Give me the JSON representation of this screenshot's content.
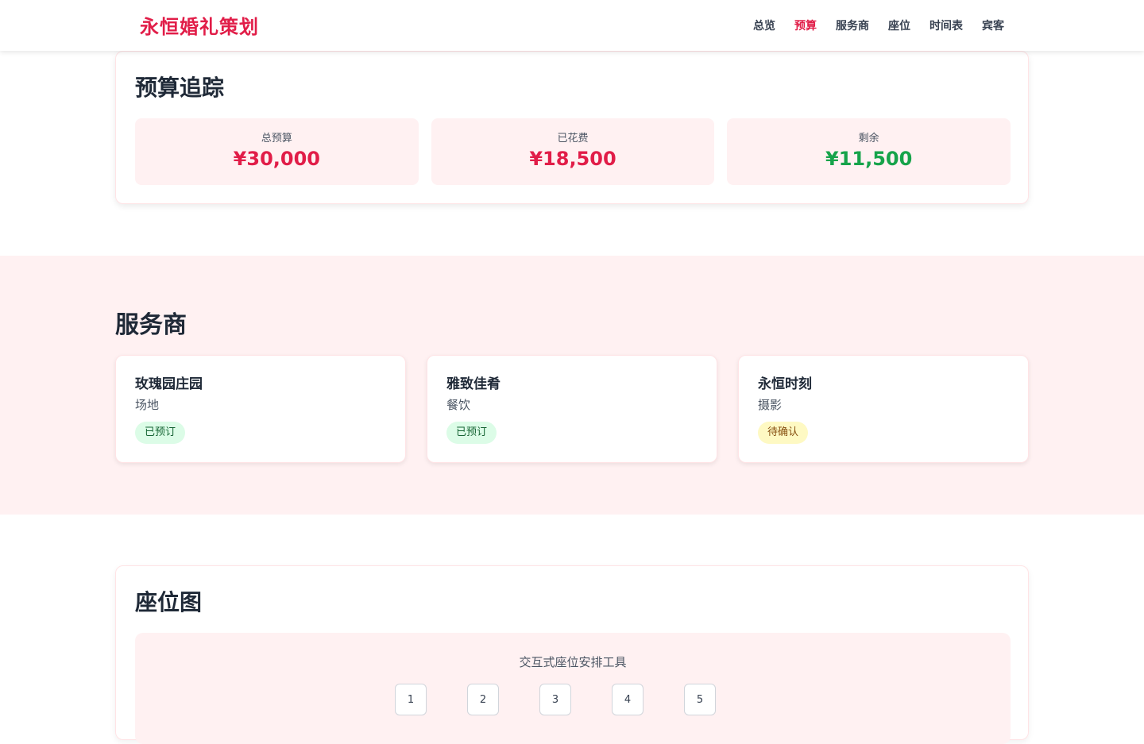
{
  "brand": "永恒婚礼策划",
  "nav": {
    "items": [
      "总览",
      "预算",
      "服务商",
      "座位",
      "时间表",
      "宾客"
    ],
    "active_index": 1
  },
  "budget": {
    "title": "预算追踪",
    "stats": [
      {
        "label": "总预算",
        "value": "¥30,000",
        "color": "#e11d48"
      },
      {
        "label": "已花费",
        "value": "¥18,500",
        "color": "#e11d48"
      },
      {
        "label": "剩余",
        "value": "¥11,500",
        "color": "#16a34a"
      }
    ]
  },
  "vendors": {
    "title": "服务商",
    "items": [
      {
        "name": "玫瑰园庄园",
        "type": "场地",
        "status": "已预订",
        "status_kind": "booked"
      },
      {
        "name": "雅致佳肴",
        "type": "餐饮",
        "status": "已预订",
        "status_kind": "booked"
      },
      {
        "name": "永恒时刻",
        "type": "摄影",
        "status": "待确认",
        "status_kind": "pending"
      }
    ]
  },
  "seating": {
    "title": "座位图",
    "subtitle": "交互式座位安排工具",
    "seats": [
      "1",
      "2",
      "3",
      "4",
      "5"
    ]
  },
  "colors": {
    "accent": "#e11d48",
    "positive": "#16a34a",
    "booked_bg": "#dcfce7",
    "booked_text": "#166534",
    "pending_bg": "#fef9c3",
    "pending_text": "#854d0e"
  }
}
